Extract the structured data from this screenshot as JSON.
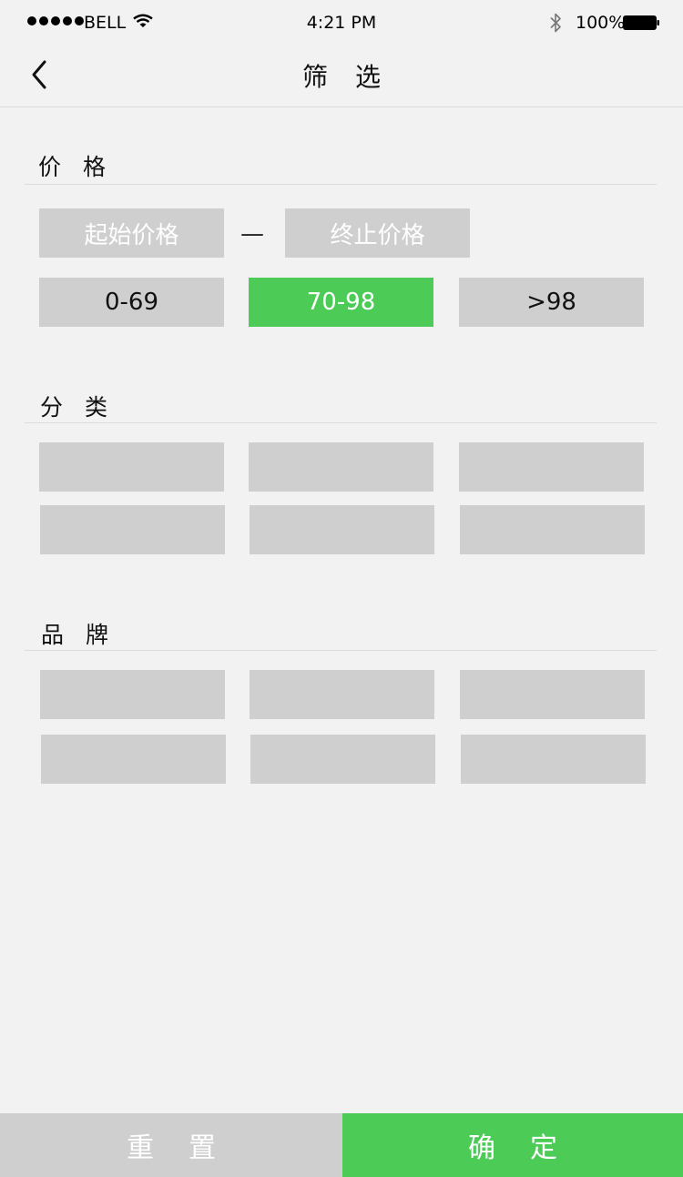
{
  "status_bar": {
    "carrier": "BELL",
    "time": "4:21 PM",
    "battery": "100%"
  },
  "nav": {
    "title": "筛选",
    "back_icon": "chevron-left-icon"
  },
  "price": {
    "label": "价格",
    "start_placeholder": "起始价格",
    "separator": "—",
    "end_placeholder": "终止价格",
    "ranges": [
      "0-69",
      "70-98",
      ">98"
    ],
    "selected": "70-98"
  },
  "category": {
    "label": "分类"
  },
  "brand": {
    "label": "品牌"
  },
  "footer": {
    "reset": "重置",
    "confirm": "确定"
  },
  "colors": {
    "accent": "#4ccb57",
    "option_bg": "#cfcfcf",
    "page_bg": "#f2f2f2"
  }
}
